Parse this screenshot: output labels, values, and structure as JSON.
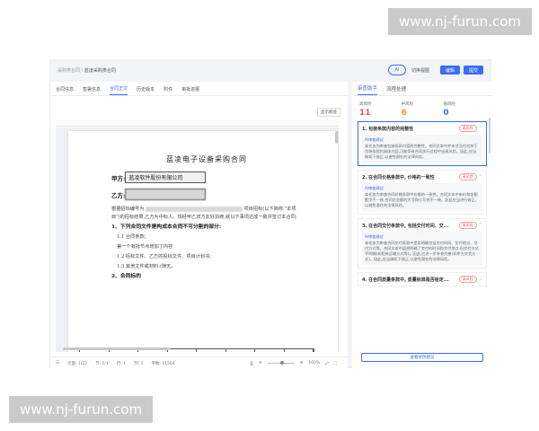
{
  "watermark": "www.nj-furun.com",
  "breadcrumb": {
    "parent": "采购类合同",
    "sep": "/",
    "current": "蓝凌采购类合同"
  },
  "topbar": {
    "ai_label": "AI",
    "switch_view": "切换视图",
    "edit_label": "编辑",
    "submit_label": "提交"
  },
  "tabs": [
    "合同信息",
    "签署信息",
    "合同正文",
    "历史版本",
    "附件",
    "审批进展"
  ],
  "active_tab": 2,
  "show_button": "显示痕迹",
  "document": {
    "title": "蓝凌电子设备采购合同",
    "party_a_label": "甲方:",
    "party_a_value": "蓝凌软件股份有限公司",
    "party_b_label": "乙方:",
    "p1_start": "根据招标编号为",
    "p1_rest": "项目招标(以下简称:\"本项目\")的招标结果,乙方为中标人。现经甲乙双方友好协商,就以下事项达成一致并签订本合同:",
    "s1": "1、下列合同文件是构成本合同不可分割的部分:",
    "s1_1": "1.1 合同条款;",
    "s1_1b": "第一个有批节点增加了内容",
    "s1_2": "1.2 招标文件、乙方的投标文件、项目计划书;",
    "s1_3": "1.3 其他文件或材料:(随无。",
    "s2": "2、合同标的"
  },
  "statusbar": {
    "page": "页面: 1/22",
    "section": "节: 1/1",
    "row": "行: 1",
    "col": "列: 1",
    "chars": "字数: 11564",
    "zoom": "100%"
  },
  "right_tabs": [
    "审查助手",
    "流程处理"
  ],
  "risk": {
    "high": {
      "label": "高风险",
      "count": "11",
      "color": "#e45757"
    },
    "mid": {
      "label": "中风险",
      "count": "6",
      "color": "#f0962e"
    },
    "low": {
      "label": "低风险",
      "count": "0",
      "color": "#3b6cf5"
    }
  },
  "issues": [
    {
      "title": "1. 包装条款内容的完整性",
      "tag": "高风险",
      "sugg_label": "AI审查建议",
      "sugg_text": "本任务为审查包装条款内容的完整性。合同文本中并未涉及任何关于包装条款的具体内容,可能导致合同执行过程中出现风险。因此,应当做如下修正,以避免潜在的法律风险。"
    },
    {
      "title": "2. 在合同价格条款中, 价格的一致性",
      "tag": "高风险",
      "sugg_label": "AI审查建议",
      "sugg_text": "本任务为审查合同价格条款中价格的一致性。合同文本中单价和金额数字不一致,合同总金额的大写和小写也不一致。因此应当进行修正,以避免潜在的法律风险。"
    },
    {
      "title": "3. 在合同交付条款中, 包括交付时间、交...",
      "tag": "高风险",
      "sugg_label": "AI审查建议",
      "sugg_text": "本任务为审查合同交付条款中是否明确包括交付时间、交付地点、交付方式等。合同文本中虽然明确了交付的时间和交付地点,但交付方式不明确(如相关运输方式等)。因此,应进一步补充完善(如甲方交货方式)。因此,应当做如下修正,以避免潜在的法律风险。"
    },
    {
      "title": "4. 在合同质量条款中, 质量标准是否给定...",
      "tag": "高风险"
    }
  ],
  "view_more": "查看修改建议"
}
